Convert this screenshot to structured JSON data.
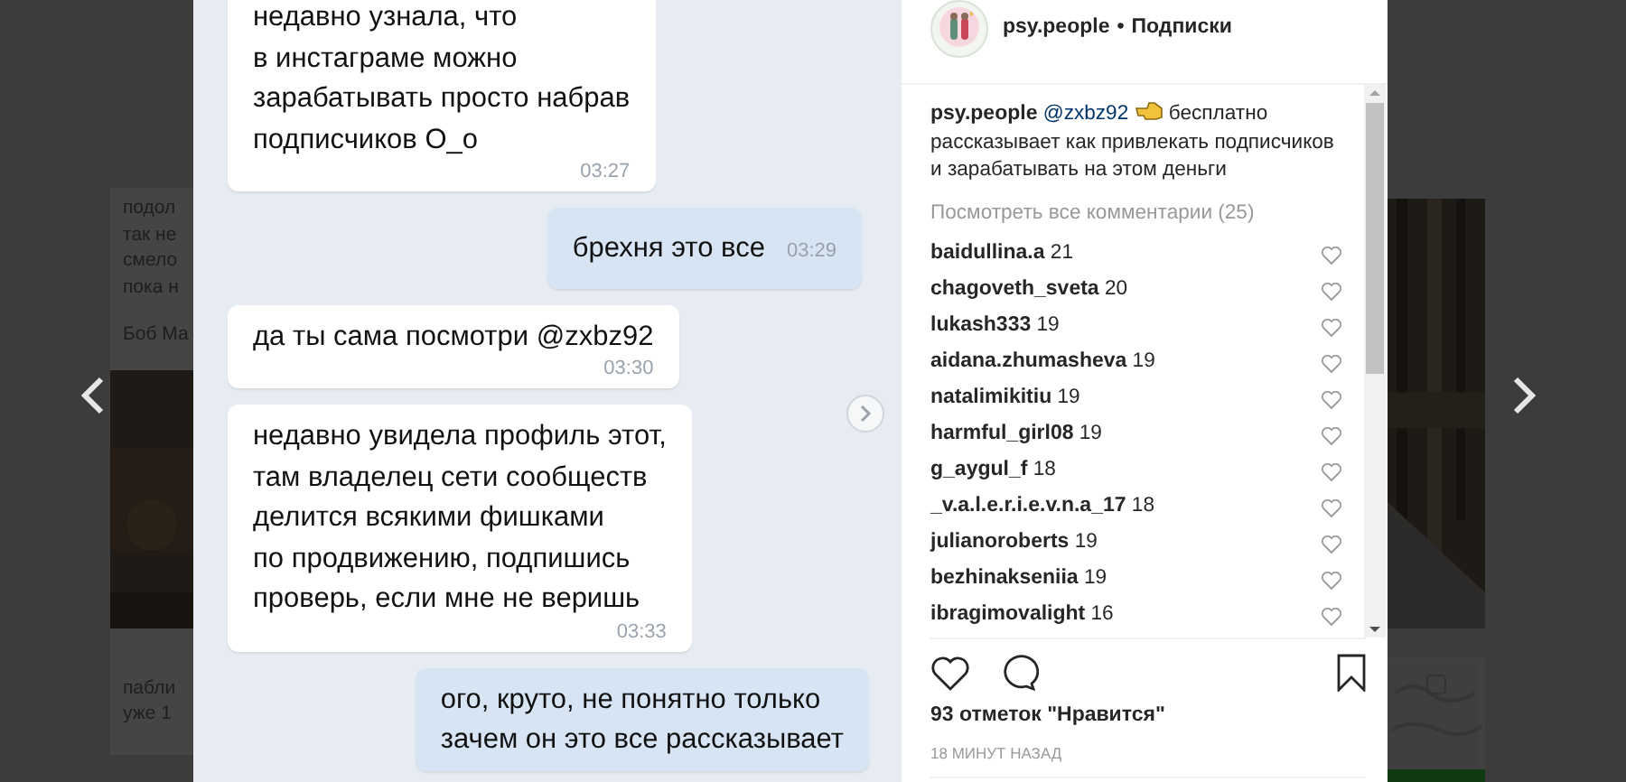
{
  "background_page": {
    "left_text": [
      "подол",
      "так не",
      "смело",
      "пока н"
    ],
    "left_author": "Боб Ма",
    "left_lower_text": [
      "пабли",
      "уже 1"
    ]
  },
  "post_image": {
    "kind": "chat_screenshot",
    "messages": [
      {
        "kind": "incoming",
        "lines": [
          "недавно узнала, что",
          "в инстаграме можно",
          "зарабатывать просто набрав",
          "подписчиков О_о"
        ],
        "time": "03:27"
      },
      {
        "kind": "outgoing",
        "lines": [
          "брехня это все"
        ],
        "time": "03:29"
      },
      {
        "kind": "incoming",
        "lines": [
          "да ты сама посмотри @zxbz92"
        ],
        "time": "03:30"
      },
      {
        "kind": "incoming",
        "lines": [
          "недавно увидела профиль этот,",
          "там владелец сети сообществ",
          "делится всякими фишками",
          "по продвижению, подпишись",
          "проверь, если мне не веришь"
        ],
        "time": "03:33"
      },
      {
        "kind": "outgoing",
        "lines": [
          "ого, круто, не понятно только",
          "зачем он это все рассказывает"
        ]
      }
    ]
  },
  "post": {
    "author": "psy.people",
    "separator": "•",
    "follow_label": "Подписки",
    "caption": {
      "author": "psy.people",
      "mention": "@zxbz92",
      "text": "бесплатно рассказывает как привлекать подписчиков и зарабатывать на этом деньги"
    },
    "view_all_comments": "Посмотреть все комментарии (25)",
    "comments": [
      {
        "user": "baidullina.a",
        "text": "21"
      },
      {
        "user": "chagoveth_sveta",
        "text": "20"
      },
      {
        "user": "lukash333",
        "text": "19"
      },
      {
        "user": "aidana.zhumasheva",
        "text": "19"
      },
      {
        "user": "natalimikitiu",
        "text": "19"
      },
      {
        "user": "harmful_girl08",
        "text": "19"
      },
      {
        "user": "g_aygul_f",
        "text": "18"
      },
      {
        "user": "_v.a.l.e.r.i.e.v.n.a_17",
        "text": "18"
      },
      {
        "user": "julianoroberts",
        "text": "19"
      },
      {
        "user": "bezhinakseniia",
        "text": "19"
      },
      {
        "user": "ibragimovalight",
        "text": "16"
      }
    ],
    "likes": "93 отметок \"Нравится\"",
    "time": "18 МИНУТ НАЗАД"
  }
}
